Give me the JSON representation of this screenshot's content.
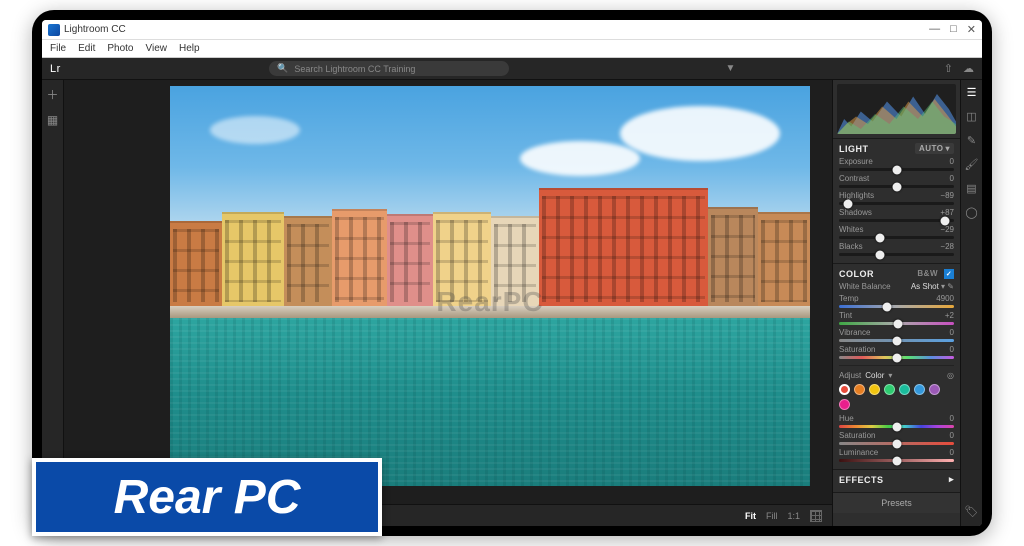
{
  "window": {
    "title": "Lightroom CC"
  },
  "menu": [
    "File",
    "Edit",
    "Photo",
    "View",
    "Help"
  ],
  "topbar": {
    "logo": "Lr",
    "search_placeholder": "Search Lightroom CC Training"
  },
  "watermark": "RearPC",
  "viewmodes": {
    "fit": "Fit",
    "fill": "Fill",
    "one": "1:1"
  },
  "panels": {
    "light": {
      "title": "LIGHT",
      "auto": "AUTO",
      "sliders": [
        {
          "label": "Exposure",
          "value": "0",
          "pos": 50
        },
        {
          "label": "Contrast",
          "value": "0",
          "pos": 50
        },
        {
          "label": "Highlights",
          "value": "−89",
          "pos": 8
        },
        {
          "label": "Shadows",
          "value": "+87",
          "pos": 92
        },
        {
          "label": "Whites",
          "value": "−29",
          "pos": 36
        },
        {
          "label": "Blacks",
          "value": "−28",
          "pos": 36
        }
      ]
    },
    "color": {
      "title": "COLOR",
      "bw": "B&W",
      "wb_label": "White Balance",
      "wb_value": "As Shot",
      "temp": {
        "label": "Temp",
        "value": "4900",
        "pos": 42
      },
      "tint": {
        "label": "Tint",
        "value": "+2",
        "pos": 51
      },
      "vibrance": {
        "label": "Vibrance",
        "value": "0",
        "pos": 50
      },
      "saturation": {
        "label": "Saturation",
        "value": "0",
        "pos": 50
      },
      "adjust_label": "Adjust",
      "adjust_mode": "Color",
      "mix_colors": [
        "#e74c3c",
        "#e67e22",
        "#f1c40f",
        "#2ecc71",
        "#1abc9c",
        "#3498db",
        "#9b59b6",
        "#e91e8c"
      ],
      "hue": {
        "label": "Hue",
        "value": "0",
        "pos": 50
      },
      "sat2": {
        "label": "Saturation",
        "value": "0",
        "pos": 50
      },
      "lum": {
        "label": "Luminance",
        "value": "0",
        "pos": 50
      }
    },
    "effects": {
      "title": "EFFECTS"
    },
    "presets": "Presets"
  },
  "banner": "Rear PC"
}
